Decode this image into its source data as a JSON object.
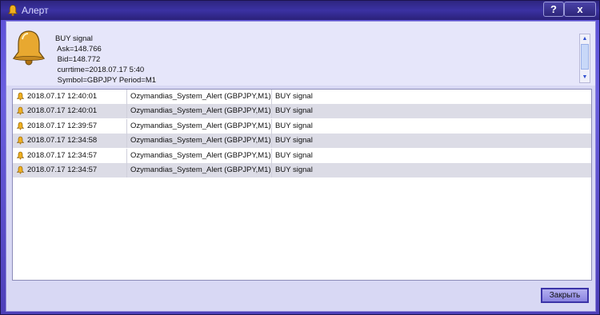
{
  "window": {
    "title": "Алерт",
    "help_label": "?",
    "close_label": "x"
  },
  "message": {
    "lines": [
      "BUY signal",
      " Ask=148.766",
      " Bid=148.772",
      " currtime=2018.07.17 5:40",
      " Symbol=GBPJPY Period=M1"
    ]
  },
  "alerts": [
    {
      "time": "2018.07.17 12:40:01",
      "source": "Ozymandias_System_Alert (GBPJPY,M1)",
      "message": "BUY signal"
    },
    {
      "time": "2018.07.17 12:40:01",
      "source": "Ozymandias_System_Alert (GBPJPY,M1)",
      "message": "BUY signal"
    },
    {
      "time": "2018.07.17 12:39:57",
      "source": "Ozymandias_System_Alert (GBPJPY,M1)",
      "message": "BUY signal"
    },
    {
      "time": "2018.07.17 12:34:58",
      "source": "Ozymandias_System_Alert (GBPJPY,M1)",
      "message": "BUY signal"
    },
    {
      "time": "2018.07.17 12:34:57",
      "source": "Ozymandias_System_Alert (GBPJPY,M1)",
      "message": "BUY signal"
    },
    {
      "time": "2018.07.17 12:34:57",
      "source": "Ozymandias_System_Alert (GBPJPY,M1)",
      "message": "BUY signal"
    }
  ],
  "buttons": {
    "close_label": "Закрыть"
  },
  "icons": {
    "title": "bell-icon",
    "message": "bell-icon",
    "row": "bell-icon"
  },
  "colors": {
    "accent": "#3c34a8",
    "alt_row": "#dcdce6"
  }
}
